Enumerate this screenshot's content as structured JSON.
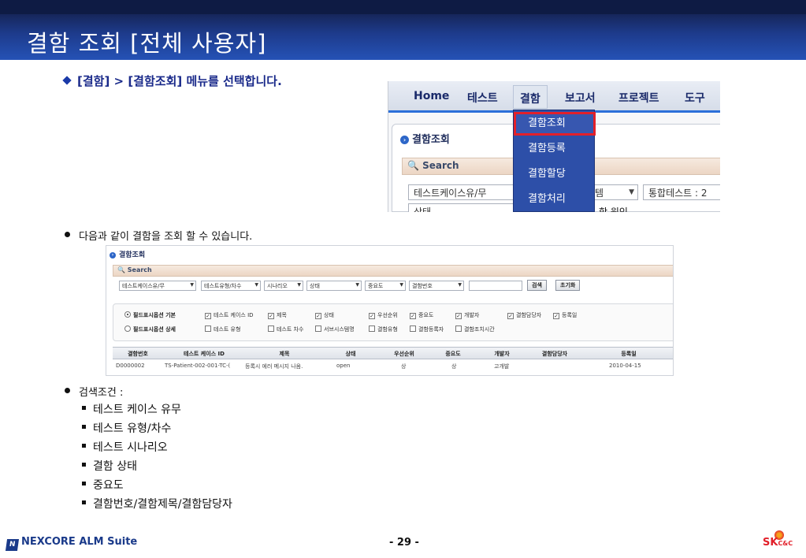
{
  "title": "결함 조회 [전체 사용자]",
  "intro": "[결함] > [결함조회] 메뉴를 선택합니다.",
  "menu_shot": {
    "nav": [
      "Home",
      "테스트",
      "결함",
      "보고서",
      "프로젝트",
      "도구"
    ],
    "panel_title": "결함조회",
    "search_label": "Search",
    "combos": [
      "테스트케이스유/무",
      "템",
      "통합테스트 : 2"
    ],
    "row2_left": "상태",
    "row2_right": "함 원인",
    "dropdown": [
      "결함조회",
      "결함등록",
      "결함할당",
      "결함처리"
    ]
  },
  "section2": "다음과 같이 결함을 조회 할 수 있습니다.",
  "search_shot": {
    "title": "결함조회",
    "search_label": "Search",
    "combos": [
      "테스트케이스유/무",
      "테스트유형/차수",
      "시나리오",
      "상태",
      "중요도",
      "결함번호"
    ],
    "buttons": [
      "검색",
      "초기화"
    ],
    "radio_default": "필드표시옵션 기본",
    "radio_detail": "필드표시옵션 상세",
    "checks_row1": [
      "테스트 케이스 ID",
      "제목",
      "상태",
      "우선순위",
      "중요도",
      "개발자",
      "결함담당자",
      "등록일"
    ],
    "checks_row2": [
      "테스트 유형",
      "테스트 차수",
      "서브시스템명",
      "결함유형",
      "결함등록자",
      "결함조치시간"
    ],
    "headers": [
      "결함번호",
      "테스트 케이스 ID",
      "제목",
      "상태",
      "우선순위",
      "중요도",
      "개발자",
      "결함담당자",
      "등록일"
    ],
    "row": [
      "D0000002",
      "TS-Patient-002-001-TC-(",
      "등록시 에러 메시지 나옴.",
      "open",
      "상",
      "상",
      "고개발",
      "",
      "2010-04-15"
    ]
  },
  "section3": {
    "label": "검색조건 :",
    "items": [
      "테스트 케이스 유무",
      "테스트 유형/차수",
      "테스트 시나리오",
      "결함 상태",
      "중요도",
      "결함번호/결함제목/결함담당자"
    ]
  },
  "footer": {
    "brand": "NEXCORE ALM Suite",
    "brand_mark": "N",
    "page": "- 29 -",
    "sk": "SK",
    "cc": "C&C"
  }
}
